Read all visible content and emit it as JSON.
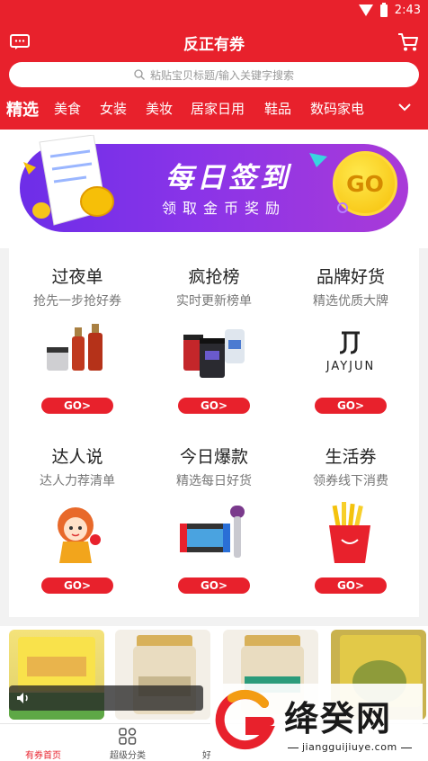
{
  "status_bar": {
    "time": "2:43"
  },
  "header": {
    "title": "反正有券",
    "message_icon": "message-icon",
    "cart_icon": "cart-icon"
  },
  "search": {
    "placeholder": "粘贴宝贝标题/输入关键字搜索"
  },
  "categories": [
    {
      "label": "精选",
      "active": true
    },
    {
      "label": "美食"
    },
    {
      "label": "女装"
    },
    {
      "label": "美妆"
    },
    {
      "label": "居家日用"
    },
    {
      "label": "鞋品"
    },
    {
      "label": "数码家电"
    }
  ],
  "banner": {
    "title": "每日签到",
    "subtitle": "领取金币奖励",
    "go_label": "GO"
  },
  "features": [
    {
      "title": "过夜单",
      "subtitle": "抢先一步抢好券",
      "go": "GO>",
      "image": "skincare-bottles"
    },
    {
      "title": "疯抢榜",
      "subtitle": "实时更新榜单",
      "go": "GO>",
      "image": "protein-supplements"
    },
    {
      "title": "品牌好货",
      "subtitle": "精选优质大牌",
      "go": "GO>",
      "image": "jayjun-logo",
      "brand_text": "JAYJUN"
    },
    {
      "title": "达人说",
      "subtitle": "达人力荐清单",
      "go": "GO>",
      "image": "cartoon-girl"
    },
    {
      "title": "今日爆款",
      "subtitle": "精选每日好货",
      "go": "GO>",
      "image": "game-console-and-dryer"
    },
    {
      "title": "生活券",
      "subtitle": "领券线下消费",
      "go": "GO>",
      "image": "french-fries"
    }
  ],
  "tabbar": [
    {
      "label": "有券首页",
      "icon": "home-icon",
      "active": true
    },
    {
      "label": "超级分类",
      "icon": "category-icon"
    },
    {
      "label": "好",
      "icon": "good-icon"
    }
  ],
  "watermark": {
    "text": "绛癸网",
    "url": "jiangguijiuye.com"
  },
  "colors": {
    "brand": "#e8212c",
    "banner_purple": "#7a30e8",
    "go_gold": "#f6bf08"
  }
}
